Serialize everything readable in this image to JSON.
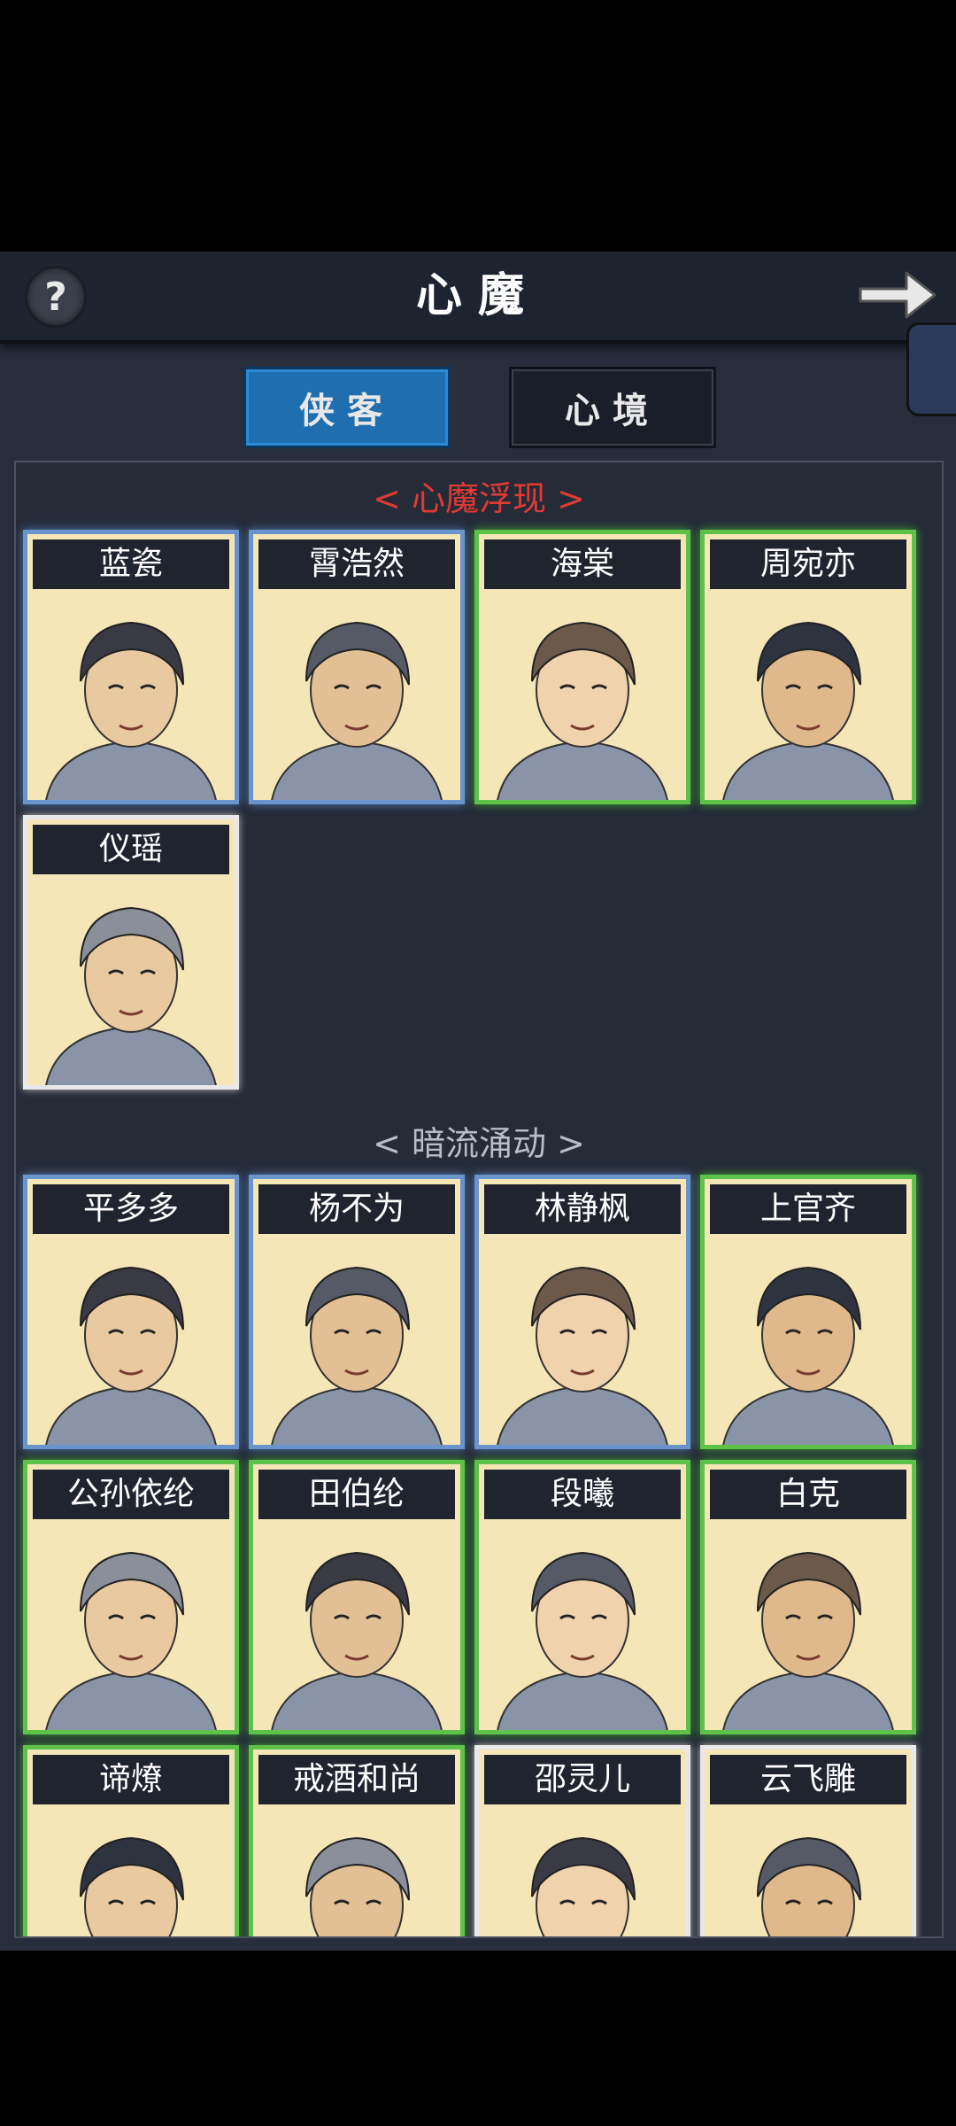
{
  "header": {
    "title": "心魔",
    "help_label": "?"
  },
  "tabs": [
    {
      "label": "侠客"
    },
    {
      "label": "心境"
    }
  ],
  "sections": [
    {
      "title": "< 心魔浮现 >"
    },
    {
      "title": "< 暗流涌动 >"
    }
  ],
  "heroes_section1": [
    {
      "name": "蓝瓷",
      "rarity": "blue"
    },
    {
      "name": "霄浩然",
      "rarity": "blue"
    },
    {
      "name": "海棠",
      "rarity": "green"
    },
    {
      "name": "周宛亦",
      "rarity": "green"
    },
    {
      "name": "仪瑶",
      "rarity": "white"
    }
  ],
  "heroes_section2": [
    {
      "name": "平多多",
      "rarity": "blue"
    },
    {
      "name": "杨不为",
      "rarity": "blue"
    },
    {
      "name": "林静枫",
      "rarity": "blue"
    },
    {
      "name": "上官齐",
      "rarity": "green"
    },
    {
      "name": "公孙依纶",
      "rarity": "green"
    },
    {
      "name": "田伯纶",
      "rarity": "green"
    },
    {
      "name": "段曦",
      "rarity": "green"
    },
    {
      "name": "白克",
      "rarity": "green"
    },
    {
      "name": "谛燎",
      "rarity": "green"
    },
    {
      "name": "戒酒和尚",
      "rarity": "green"
    },
    {
      "name": "邵灵儿",
      "rarity": "white"
    },
    {
      "name": "云飞雕",
      "rarity": "white"
    }
  ],
  "colors": {
    "panel_bg": "#272d3b",
    "active_tab": "#1f6fb0",
    "rarity_blue": "#6a94cc",
    "rarity_green": "#5ec24a",
    "rarity_white": "#e8e8e8",
    "section_red": "#e03a34"
  },
  "icons": {
    "help": "question-mark-icon",
    "next": "arrow-right-icon"
  }
}
